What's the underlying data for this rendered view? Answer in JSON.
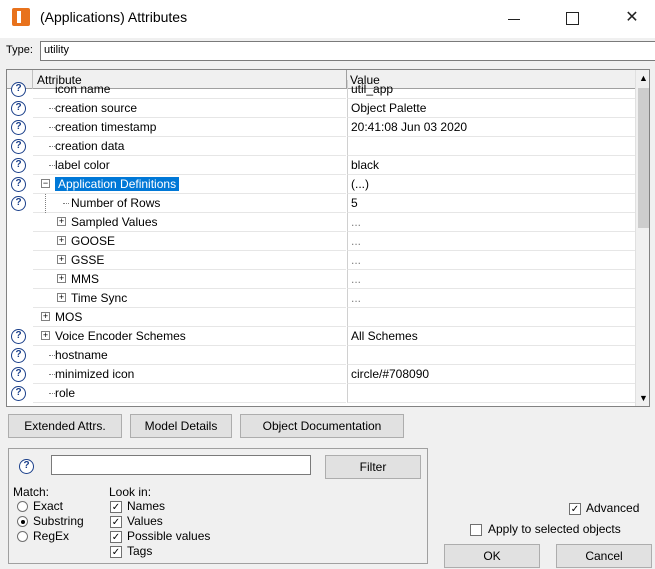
{
  "window": {
    "title": "(Applications) Attributes"
  },
  "type_field": {
    "label": "Type:",
    "value": "utility"
  },
  "grid": {
    "col_attribute": "Attribute",
    "col_value": "Value",
    "rows": [
      {
        "name": "icon name",
        "value": "util_app",
        "partial": true
      },
      {
        "name": "creation source",
        "value": "Object Palette"
      },
      {
        "name": "creation timestamp",
        "value": "20:41:08 Jun 03 2020"
      },
      {
        "name": "creation data",
        "value": ""
      },
      {
        "name": "label color",
        "value": "black"
      },
      {
        "name": "Application Definitions",
        "value": "(...)",
        "selected": true
      },
      {
        "name": "Number of Rows",
        "value": "5"
      },
      {
        "name": "Sampled Values",
        "value": "..."
      },
      {
        "name": "GOOSE",
        "value": "..."
      },
      {
        "name": "GSSE",
        "value": "..."
      },
      {
        "name": "MMS",
        "value": "..."
      },
      {
        "name": "Time Sync",
        "value": "..."
      },
      {
        "name": "MOS",
        "value": ""
      },
      {
        "name": "Voice Encoder Schemes",
        "value": "All Schemes"
      },
      {
        "name": "hostname",
        "value": ""
      },
      {
        "name": "minimized icon",
        "value": "circle/#708090"
      },
      {
        "name": "role",
        "value": ""
      }
    ]
  },
  "buttons": {
    "extended_attrs": "Extended Attrs.",
    "model_details": "Model Details",
    "object_documentation": "Object Documentation",
    "filter": "Filter",
    "ok": "OK",
    "cancel": "Cancel"
  },
  "filter": {
    "value": "",
    "match_label": "Match:",
    "match_options": [
      "Exact",
      "Substring",
      "RegEx"
    ],
    "match_selected": "Substring",
    "look_in_label": "Look in:",
    "look_in": [
      "Names",
      "Values",
      "Possible values",
      "Tags"
    ]
  },
  "options": {
    "advanced": "Advanced",
    "apply_selected": "Apply to selected objects"
  },
  "icons": {
    "help": "question-mark-icon",
    "expand": "plus-box-icon",
    "collapse": "minus-box-icon"
  },
  "colors": {
    "selection": "#0078d7",
    "app_icon": "#e8721c",
    "help_icon": "#1a3f8a"
  }
}
